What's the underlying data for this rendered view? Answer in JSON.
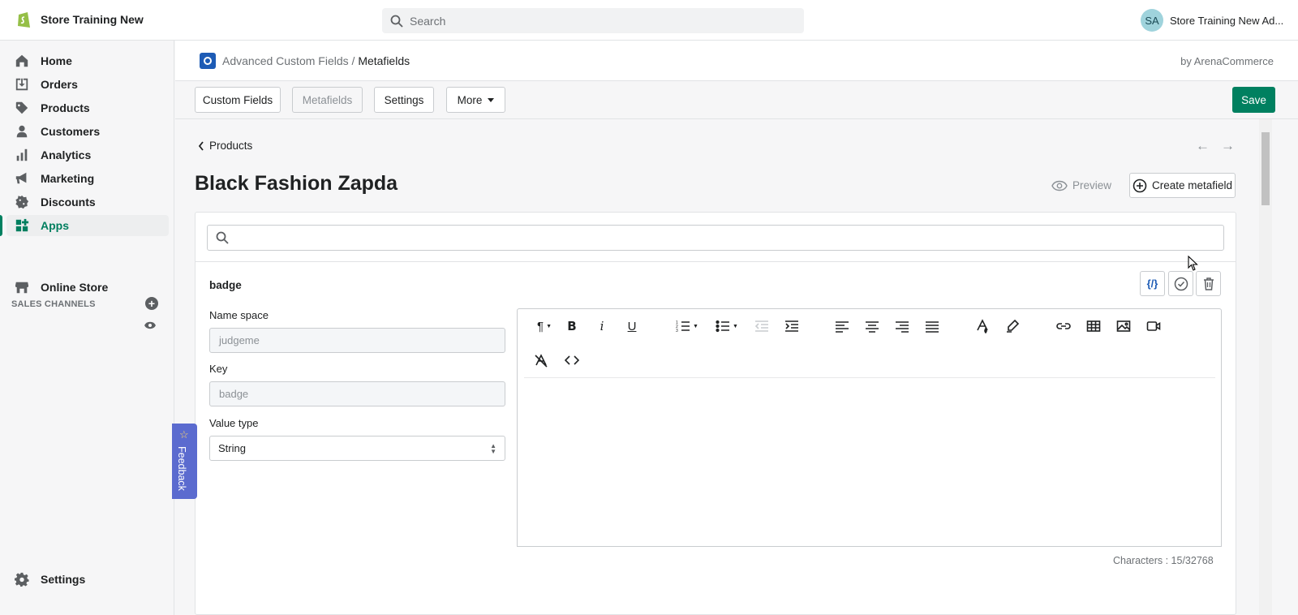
{
  "topbar": {
    "store_name": "Store Training New",
    "search_placeholder": "Search",
    "user_initials": "SA",
    "user_name": "Store Training New Ad..."
  },
  "sidebar": {
    "items": [
      {
        "label": "Home",
        "icon": "home-icon"
      },
      {
        "label": "Orders",
        "icon": "orders-icon"
      },
      {
        "label": "Products",
        "icon": "tag-icon"
      },
      {
        "label": "Customers",
        "icon": "person-icon"
      },
      {
        "label": "Analytics",
        "icon": "bar-chart-icon"
      },
      {
        "label": "Marketing",
        "icon": "megaphone-icon"
      },
      {
        "label": "Discounts",
        "icon": "discount-icon"
      },
      {
        "label": "Apps",
        "icon": "apps-icon",
        "active": true
      }
    ],
    "sales_channels_title": "SALES CHANNELS",
    "online_store": "Online Store",
    "settings": "Settings"
  },
  "app_header": {
    "app_name": "Advanced Custom Fields",
    "separator": "/",
    "current": "Metafields",
    "by": "by ArenaCommerce"
  },
  "toolbar": {
    "custom_fields": "Custom Fields",
    "metafields": "Metafields",
    "settings": "Settings",
    "more": "More",
    "save": "Save"
  },
  "page": {
    "back_label": "Products",
    "title": "Black Fashion Zapda",
    "preview": "Preview",
    "create_metafield": "Create metafield"
  },
  "metafield": {
    "title": "badge",
    "namespace_label": "Name space",
    "namespace_value": "judgeme",
    "key_label": "Key",
    "key_value": "badge",
    "value_type_label": "Value type",
    "value_type": "String",
    "code_toggle": "{/}",
    "characters": "Characters : 15/32768"
  },
  "feedback": "Feedback",
  "colors": {
    "primary": "#008060",
    "app_blue": "#1d5bb5",
    "feedback": "#5b6bcf"
  }
}
